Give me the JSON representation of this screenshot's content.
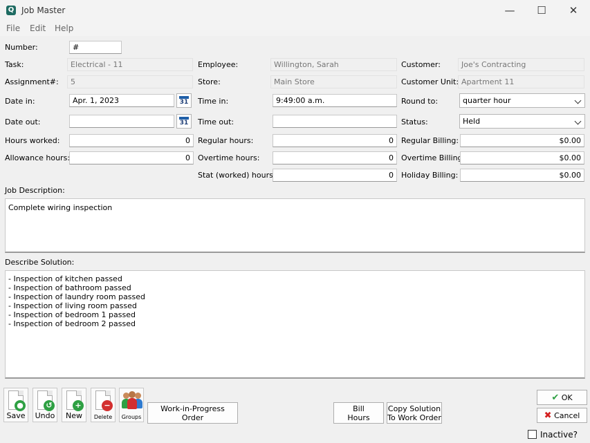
{
  "window": {
    "title": "Job Master",
    "app_icon_letter": "Q",
    "minimize": "—",
    "maximize": "☐",
    "close": "✕"
  },
  "menu": {
    "file": "File",
    "edit": "Edit",
    "help": "Help"
  },
  "form": {
    "number": {
      "label": "Number:",
      "value": "#"
    },
    "task": {
      "label": "Task:",
      "value": "Electrical - 11"
    },
    "employee": {
      "label": "Employee:",
      "value": "Willington, Sarah"
    },
    "customer": {
      "label": "Customer:",
      "value": "Joe's Contracting"
    },
    "assignment": {
      "label": "Assignment#:",
      "value": "5"
    },
    "store": {
      "label": "Store:",
      "value": "Main Store"
    },
    "customer_unit": {
      "label": "Customer Unit:",
      "value": "Apartment 11"
    },
    "date_in": {
      "label": "Date in:",
      "value": "Apr. 1, 2023"
    },
    "time_in": {
      "label": "Time in:",
      "value": "9:49:00 a.m."
    },
    "round_to": {
      "label": "Round to:",
      "value": "quarter hour"
    },
    "date_out": {
      "label": "Date out:",
      "value": ""
    },
    "time_out": {
      "label": "Time out:",
      "value": ""
    },
    "status": {
      "label": "Status:",
      "value": "Held"
    },
    "hours_worked": {
      "label": "Hours worked:",
      "value": "0"
    },
    "regular_hours": {
      "label": "Regular hours:",
      "value": "0"
    },
    "regular_billing": {
      "label": "Regular Billing:",
      "value": "$0.00"
    },
    "allowance_hours": {
      "label": "Allowance hours:",
      "value": "0"
    },
    "overtime_hours": {
      "label": "Overtime hours:",
      "value": "0"
    },
    "overtime_billing": {
      "label": "Overtime Billing:",
      "value": "$0.00"
    },
    "stat_hours": {
      "label": "Stat (worked) hours:",
      "value": "0"
    },
    "holiday_billing": {
      "label": "Holiday Billing:",
      "value": "$0.00"
    },
    "calendar_day": "31"
  },
  "job_description": {
    "label": "Job Description:",
    "text": "Complete wiring inspection"
  },
  "solution": {
    "label": "Describe Solution:",
    "lines": [
      "- Inspection of kitchen passed",
      "- Inspection of bathroom passed",
      "- Inspection of laundry room passed",
      "- Inspection of living room passed",
      "- Inspection of bedroom 1 passed",
      "- Inspection of bedroom 2 passed"
    ]
  },
  "toolbar": {
    "save": "Save",
    "undo": "Undo",
    "new": "New",
    "delete": "Delete",
    "groups": "Groups",
    "wip_line1": "Work-in-Progress",
    "wip_line2": "Order",
    "bill_line1": "Bill",
    "bill_line2": "Hours",
    "copy_line1": "Copy Solution",
    "copy_line2": "To Work Order",
    "ok": "OK",
    "cancel": "Cancel",
    "inactive": "Inactive?"
  },
  "icons": {
    "save": "save-icon",
    "undo": "undo-icon",
    "new": "new-icon",
    "delete": "delete-icon",
    "groups": "groups-icon",
    "ok": "checkmark-icon",
    "cancel": "cross-icon",
    "calendar": "calendar-icon"
  },
  "colors": {
    "accent_green": "#2ea043",
    "delete_red": "#d32f2f",
    "calendar_blue": "#1f5fa8",
    "cancel_red": "#d42020"
  }
}
